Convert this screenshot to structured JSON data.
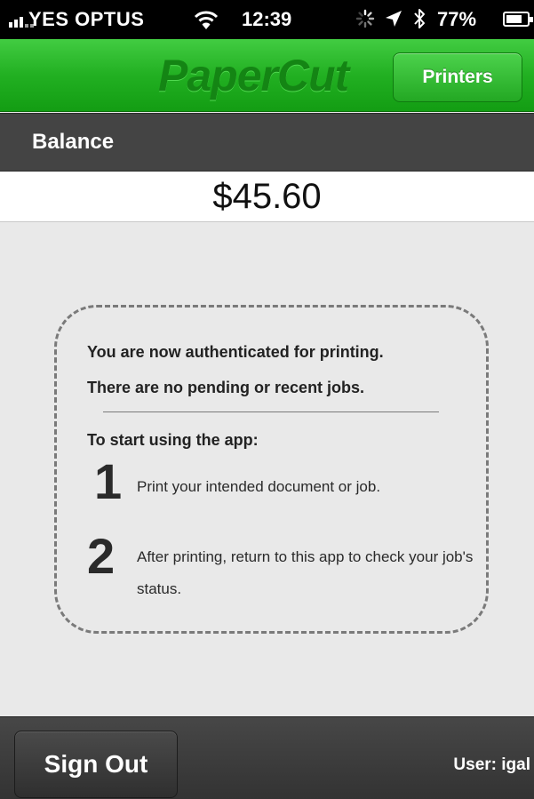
{
  "status_bar": {
    "carrier": "YES OPTUS",
    "time": "12:39",
    "battery_percent": "77%",
    "battery_level": 0.77,
    "icons": [
      "signal-icon",
      "wifi-icon",
      "activity-spinner-icon",
      "location-icon",
      "bluetooth-icon",
      "battery-icon"
    ]
  },
  "nav_bar": {
    "logo": "PaperCut",
    "printers_button": "Printers"
  },
  "balance": {
    "label": "Balance",
    "amount": "$45.60"
  },
  "info": {
    "line1": "You are now authenticated for printing.",
    "line2": "There are no pending or recent jobs.",
    "start_label": "To start using the app:",
    "steps": [
      {
        "number": "1",
        "text": "Print your intended document or job."
      },
      {
        "number": "2",
        "text": "After printing, return to this app to check your job's status."
      }
    ]
  },
  "bottom_bar": {
    "sign_out": "Sign Out",
    "user_label": "User: igal"
  },
  "colors": {
    "nav_green": "#22b022",
    "logo_green": "#148514",
    "header_dark": "#444444",
    "background": "#e9e9e9"
  }
}
